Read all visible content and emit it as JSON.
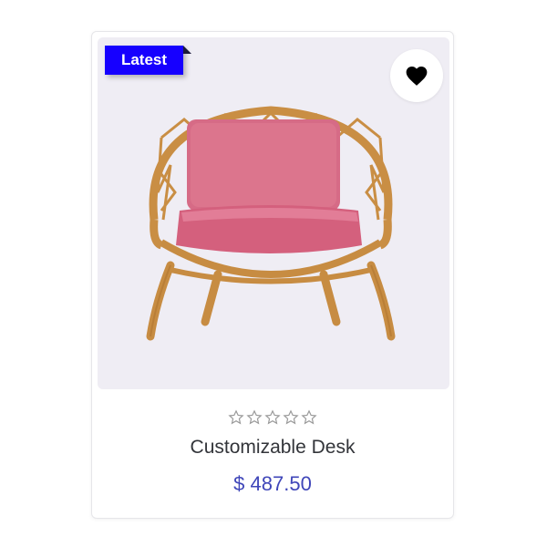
{
  "product": {
    "badge": "Latest",
    "name": "Customizable Desk",
    "price": "$ 487.50",
    "rating": 0,
    "rating_max": 5,
    "wishlist_icon": "heart-icon",
    "image_alt": "rattan chair with pink cushion"
  },
  "colors": {
    "badge_bg": "#1600ff",
    "price": "#3f46b9",
    "image_bg": "#efedf4"
  }
}
